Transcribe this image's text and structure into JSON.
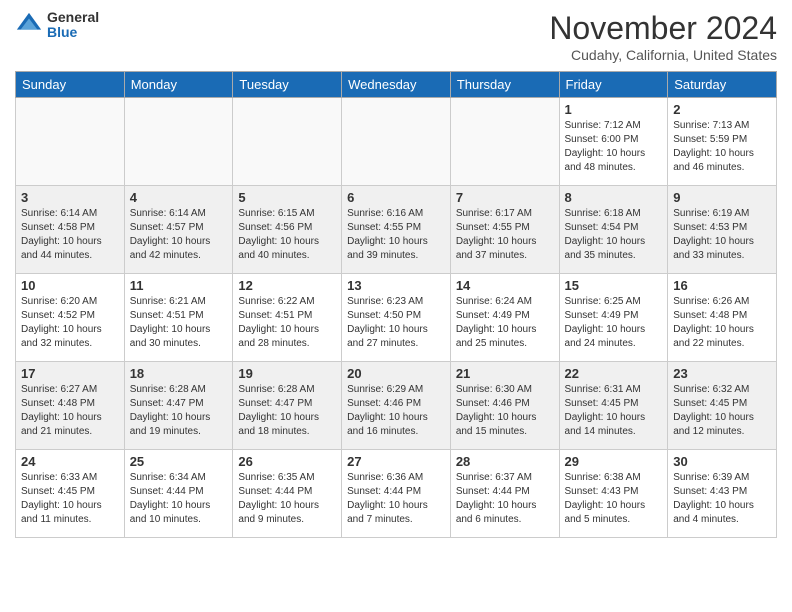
{
  "logo": {
    "general": "General",
    "blue": "Blue"
  },
  "header": {
    "month": "November 2024",
    "location": "Cudahy, California, United States"
  },
  "weekdays": [
    "Sunday",
    "Monday",
    "Tuesday",
    "Wednesday",
    "Thursday",
    "Friday",
    "Saturday"
  ],
  "weeks": [
    [
      {
        "day": "",
        "info": ""
      },
      {
        "day": "",
        "info": ""
      },
      {
        "day": "",
        "info": ""
      },
      {
        "day": "",
        "info": ""
      },
      {
        "day": "",
        "info": ""
      },
      {
        "day": "1",
        "info": "Sunrise: 7:12 AM\nSunset: 6:00 PM\nDaylight: 10 hours and 48 minutes."
      },
      {
        "day": "2",
        "info": "Sunrise: 7:13 AM\nSunset: 5:59 PM\nDaylight: 10 hours and 46 minutes."
      }
    ],
    [
      {
        "day": "3",
        "info": "Sunrise: 6:14 AM\nSunset: 4:58 PM\nDaylight: 10 hours and 44 minutes."
      },
      {
        "day": "4",
        "info": "Sunrise: 6:14 AM\nSunset: 4:57 PM\nDaylight: 10 hours and 42 minutes."
      },
      {
        "day": "5",
        "info": "Sunrise: 6:15 AM\nSunset: 4:56 PM\nDaylight: 10 hours and 40 minutes."
      },
      {
        "day": "6",
        "info": "Sunrise: 6:16 AM\nSunset: 4:55 PM\nDaylight: 10 hours and 39 minutes."
      },
      {
        "day": "7",
        "info": "Sunrise: 6:17 AM\nSunset: 4:55 PM\nDaylight: 10 hours and 37 minutes."
      },
      {
        "day": "8",
        "info": "Sunrise: 6:18 AM\nSunset: 4:54 PM\nDaylight: 10 hours and 35 minutes."
      },
      {
        "day": "9",
        "info": "Sunrise: 6:19 AM\nSunset: 4:53 PM\nDaylight: 10 hours and 33 minutes."
      }
    ],
    [
      {
        "day": "10",
        "info": "Sunrise: 6:20 AM\nSunset: 4:52 PM\nDaylight: 10 hours and 32 minutes."
      },
      {
        "day": "11",
        "info": "Sunrise: 6:21 AM\nSunset: 4:51 PM\nDaylight: 10 hours and 30 minutes."
      },
      {
        "day": "12",
        "info": "Sunrise: 6:22 AM\nSunset: 4:51 PM\nDaylight: 10 hours and 28 minutes."
      },
      {
        "day": "13",
        "info": "Sunrise: 6:23 AM\nSunset: 4:50 PM\nDaylight: 10 hours and 27 minutes."
      },
      {
        "day": "14",
        "info": "Sunrise: 6:24 AM\nSunset: 4:49 PM\nDaylight: 10 hours and 25 minutes."
      },
      {
        "day": "15",
        "info": "Sunrise: 6:25 AM\nSunset: 4:49 PM\nDaylight: 10 hours and 24 minutes."
      },
      {
        "day": "16",
        "info": "Sunrise: 6:26 AM\nSunset: 4:48 PM\nDaylight: 10 hours and 22 minutes."
      }
    ],
    [
      {
        "day": "17",
        "info": "Sunrise: 6:27 AM\nSunset: 4:48 PM\nDaylight: 10 hours and 21 minutes."
      },
      {
        "day": "18",
        "info": "Sunrise: 6:28 AM\nSunset: 4:47 PM\nDaylight: 10 hours and 19 minutes."
      },
      {
        "day": "19",
        "info": "Sunrise: 6:28 AM\nSunset: 4:47 PM\nDaylight: 10 hours and 18 minutes."
      },
      {
        "day": "20",
        "info": "Sunrise: 6:29 AM\nSunset: 4:46 PM\nDaylight: 10 hours and 16 minutes."
      },
      {
        "day": "21",
        "info": "Sunrise: 6:30 AM\nSunset: 4:46 PM\nDaylight: 10 hours and 15 minutes."
      },
      {
        "day": "22",
        "info": "Sunrise: 6:31 AM\nSunset: 4:45 PM\nDaylight: 10 hours and 14 minutes."
      },
      {
        "day": "23",
        "info": "Sunrise: 6:32 AM\nSunset: 4:45 PM\nDaylight: 10 hours and 12 minutes."
      }
    ],
    [
      {
        "day": "24",
        "info": "Sunrise: 6:33 AM\nSunset: 4:45 PM\nDaylight: 10 hours and 11 minutes."
      },
      {
        "day": "25",
        "info": "Sunrise: 6:34 AM\nSunset: 4:44 PM\nDaylight: 10 hours and 10 minutes."
      },
      {
        "day": "26",
        "info": "Sunrise: 6:35 AM\nSunset: 4:44 PM\nDaylight: 10 hours and 9 minutes."
      },
      {
        "day": "27",
        "info": "Sunrise: 6:36 AM\nSunset: 4:44 PM\nDaylight: 10 hours and 7 minutes."
      },
      {
        "day": "28",
        "info": "Sunrise: 6:37 AM\nSunset: 4:44 PM\nDaylight: 10 hours and 6 minutes."
      },
      {
        "day": "29",
        "info": "Sunrise: 6:38 AM\nSunset: 4:43 PM\nDaylight: 10 hours and 5 minutes."
      },
      {
        "day": "30",
        "info": "Sunrise: 6:39 AM\nSunset: 4:43 PM\nDaylight: 10 hours and 4 minutes."
      }
    ]
  ]
}
